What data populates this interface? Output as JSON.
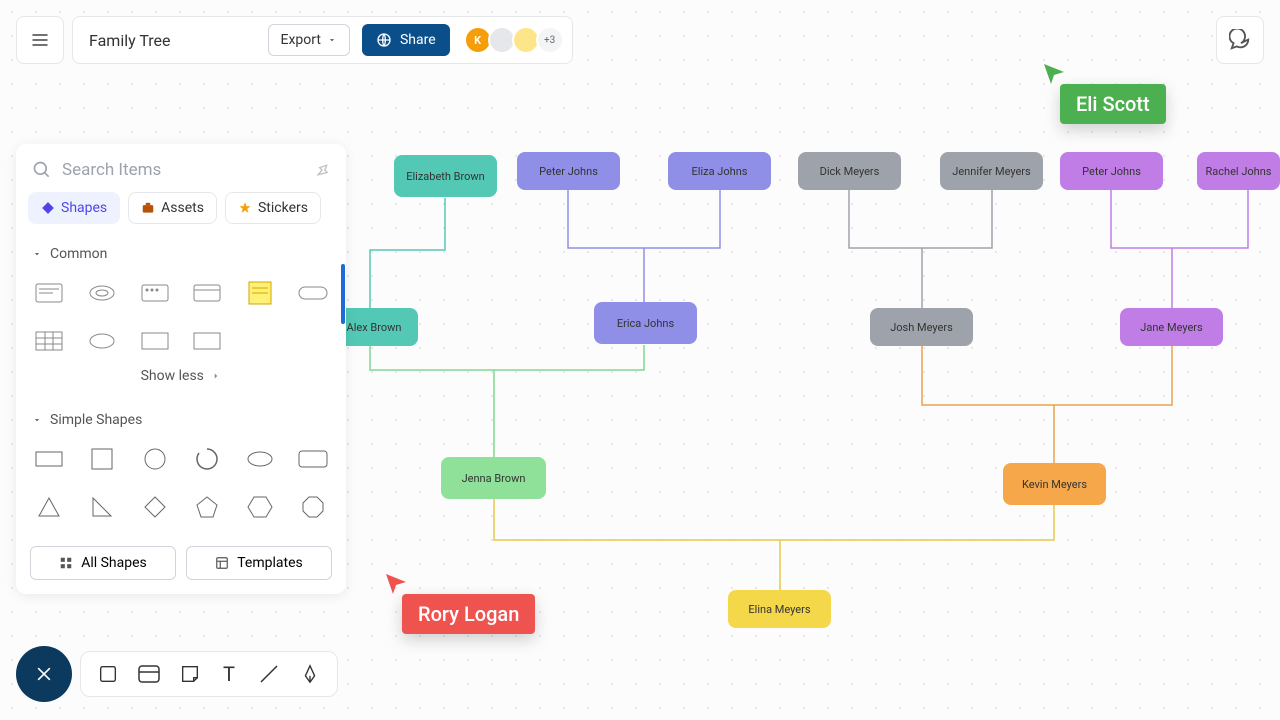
{
  "header": {
    "title": "Family Tree",
    "export_label": "Export",
    "share_label": "Share",
    "avatar1": "K",
    "more_count": "+3"
  },
  "search": {
    "placeholder": "Search Items"
  },
  "tabs": {
    "shapes": "Shapes",
    "assets": "Assets",
    "stickers": "Stickers"
  },
  "sections": {
    "common": "Common",
    "simple": "Simple Shapes",
    "showless": "Show less"
  },
  "actions": {
    "all_shapes": "All Shapes",
    "templates": "Templates"
  },
  "nodes": {
    "elizabeth": "Elizabeth Brown",
    "peter1": "Peter Johns",
    "eliza": "Eliza Johns",
    "dick": "Dick Meyers",
    "jennifer": "Jennifer Meyers",
    "peter2": "Peter Johns",
    "rachel": "Rachel Johns",
    "alex": "Alex Brown",
    "erica": "Erica Johns",
    "josh": "Josh Meyers",
    "jane": "Jane Meyers",
    "jenna": "Jenna Brown",
    "kevin": "Kevin Meyers",
    "elina": "Elina Meyers"
  },
  "cursors": {
    "eli": "Eli Scott",
    "rory": "Rory Logan"
  }
}
